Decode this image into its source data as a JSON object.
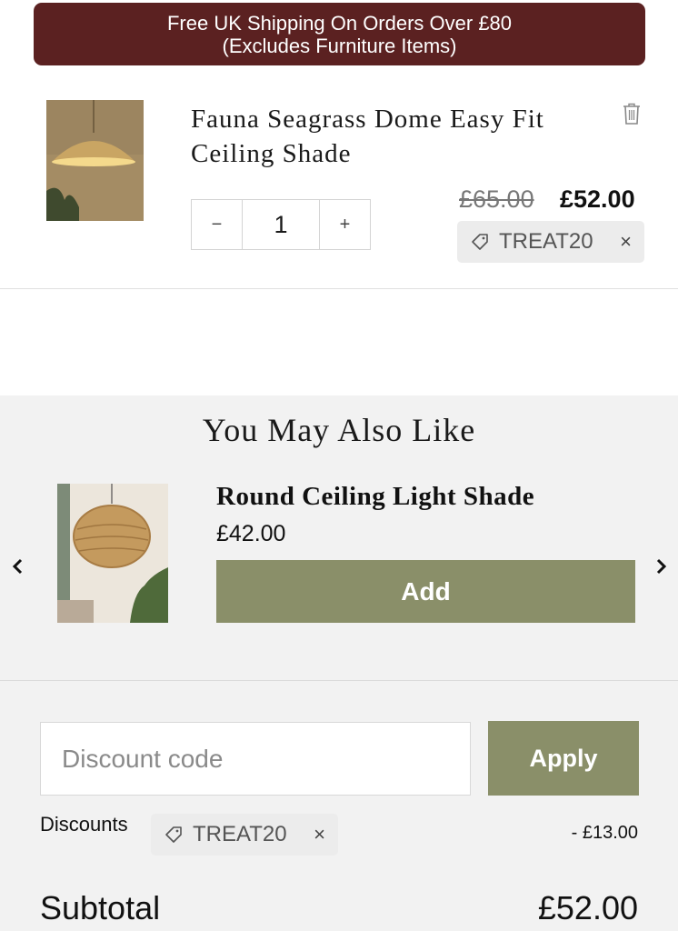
{
  "banner": {
    "line1": "Free UK Shipping On Orders Over £80",
    "line2": "(Excludes Furniture Items)",
    "color": "#5b2121"
  },
  "cart_item": {
    "title": "Fauna Seagrass Dome Easy Fit Ceiling Shade",
    "quantity": "1",
    "decrease_label": "−",
    "increase_label": "+",
    "original_price": "£65.00",
    "price": "£52.00",
    "discount_tag": "TREAT20",
    "remove_tag_label": "×",
    "delete_icon": "trash-icon"
  },
  "upsell": {
    "heading": "You May Also Like",
    "product": {
      "title": "Round Ceiling Light Shade",
      "price": "£42.00",
      "add_label": "Add"
    },
    "prev_icon": "chevron-left-icon",
    "next_icon": "chevron-right-icon"
  },
  "discount": {
    "placeholder": "Discount code",
    "apply_label": "Apply",
    "label": "Discounts",
    "tag": "TREAT20",
    "remove_label": "×",
    "amount": "- £13.00"
  },
  "totals": {
    "subtotal_label": "Subtotal",
    "subtotal_value": "£52.00"
  },
  "colors": {
    "accent": "#8a8f69",
    "banner": "#5b2121",
    "panel": "#f2f2f2"
  }
}
